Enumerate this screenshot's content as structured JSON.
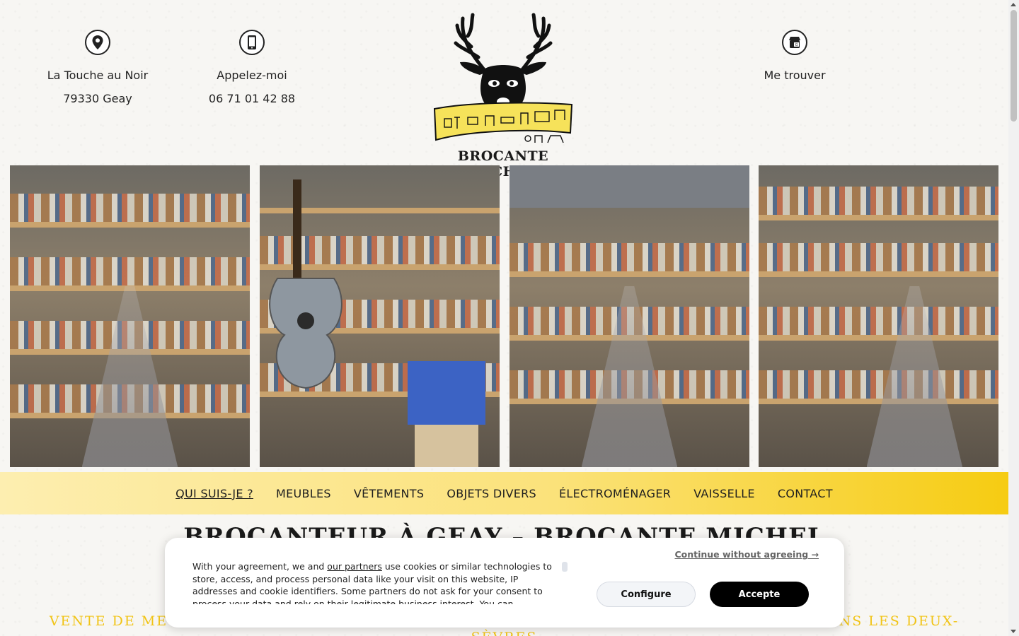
{
  "header": {
    "address": {
      "icon": "map-pin-icon",
      "line1": "La Touche au Noir",
      "line2": "79330 Geay"
    },
    "phone": {
      "icon": "smartphone-icon",
      "line1": "Appelez-moi",
      "line2": "06 71 01 42 88"
    },
    "find": {
      "icon": "store-icon",
      "line1": "Me trouver"
    },
    "logo": {
      "icon": "deer-head-logo",
      "text": "BROCANTE MICHEL"
    }
  },
  "gallery": {
    "photos": [
      "brocante-aisle-books",
      "brocante-guitar-pottery",
      "brocante-long-aisle",
      "brocante-glassware-aisle"
    ]
  },
  "nav": {
    "items": [
      {
        "label": "QUI SUIS-JE ?",
        "active": true
      },
      {
        "label": "MEUBLES",
        "active": false
      },
      {
        "label": "VÊTEMENTS",
        "active": false
      },
      {
        "label": "OBJETS DIVERS",
        "active": false
      },
      {
        "label": "ÉLECTROMÉNAGER",
        "active": false
      },
      {
        "label": "VAISSELLE",
        "active": false
      },
      {
        "label": "CONTACT",
        "active": false
      }
    ]
  },
  "main": {
    "title": "BROCANTEUR À GEAY – BROCANTE MICHEL",
    "subtitle_left": "VENTE DE MEUBLES",
    "subtitle_right": "DANS LES DEUX-",
    "subtitle_line2": "SÈVRES"
  },
  "cookie": {
    "text_before_link": "With your agreement, we and ",
    "link": "our partners",
    "text_after_link": " use cookies or similar technologies to store, access, and process personal data like your visit on this website, IP addresses and cookie identifiers. Some partners do not ask for your consent to process your data and rely on their legitimate business interest. You can",
    "continue": "Continue without agreeing →",
    "configure": "Configure",
    "accept": "Accepte"
  },
  "colors": {
    "nav_gradient_start": "#fdeeb0",
    "nav_gradient_end": "#f6cc12",
    "subtitle": "#f1c416",
    "accept_button": "#000000"
  }
}
